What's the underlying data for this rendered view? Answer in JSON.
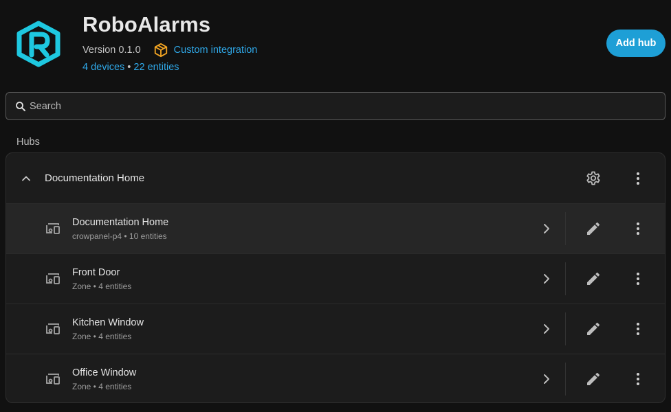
{
  "integration": {
    "title": "RoboAlarms",
    "version": "Version 0.1.0",
    "custom_label": "Custom integration",
    "devices_link": "4 devices",
    "separator": " • ",
    "entities_link": "22 entities",
    "logo_icon": "roboalarms-logo-icon",
    "accent_color": "#1ec8e0"
  },
  "actions": {
    "add_hub_label": "Add hub"
  },
  "search": {
    "placeholder": "Search"
  },
  "hubs_section": {
    "title": "Hubs",
    "hub": {
      "name": "Documentation Home",
      "devices": [
        {
          "name": "Documentation Home",
          "subtitle": "crowpanel-p4 • 10 entities"
        },
        {
          "name": "Front Door",
          "subtitle": "Zone • 4 entities"
        },
        {
          "name": "Kitchen Window",
          "subtitle": "Zone • 4 entities"
        },
        {
          "name": "Office Window",
          "subtitle": "Zone • 4 entities"
        }
      ]
    }
  },
  "colors": {
    "primary": "#1e9fd6",
    "link": "#2fa8e8",
    "package": "#f5a623",
    "background": "#111111",
    "card": "#1c1c1c"
  }
}
